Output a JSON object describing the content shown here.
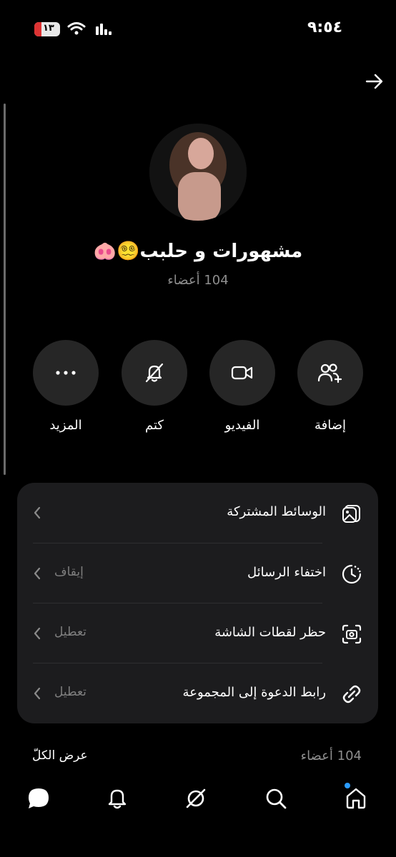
{
  "status_bar": {
    "time": "٩:٥٤",
    "battery": "١٣"
  },
  "group": {
    "title": "مشهورات و حلبب😵‍💫🐽",
    "members": "104 أعضاء"
  },
  "actions": [
    {
      "label": "إضافة",
      "icon": "add-users-icon"
    },
    {
      "label": "الفيديو",
      "icon": "video-icon"
    },
    {
      "label": "كتم",
      "icon": "mute-bell-icon"
    },
    {
      "label": "المزيد",
      "icon": "more-dots-icon"
    }
  ],
  "settings": [
    {
      "title": "الوسائط المشتركة",
      "value": "",
      "icon": "media-icon"
    },
    {
      "title": "اختفاء الرسائل",
      "value": "إيقاف",
      "icon": "timer-icon"
    },
    {
      "title": "حظر لقطات الشاشة",
      "value": "تعطيل",
      "icon": "screenshot-icon"
    },
    {
      "title": "رابط الدعوة إلى المجموعة",
      "value": "تعطيل",
      "icon": "link-icon"
    }
  ],
  "members_section": {
    "count": "104 أعضاء",
    "view_all": "عرض الكلّ"
  },
  "nav": [
    "home-icon",
    "search-icon",
    "explore-icon",
    "notifications-icon",
    "chat-icon"
  ],
  "colors": {
    "background": "#000000",
    "card": "#1c1c1e",
    "button": "#262626",
    "accent_dot": "#2a9bff"
  }
}
